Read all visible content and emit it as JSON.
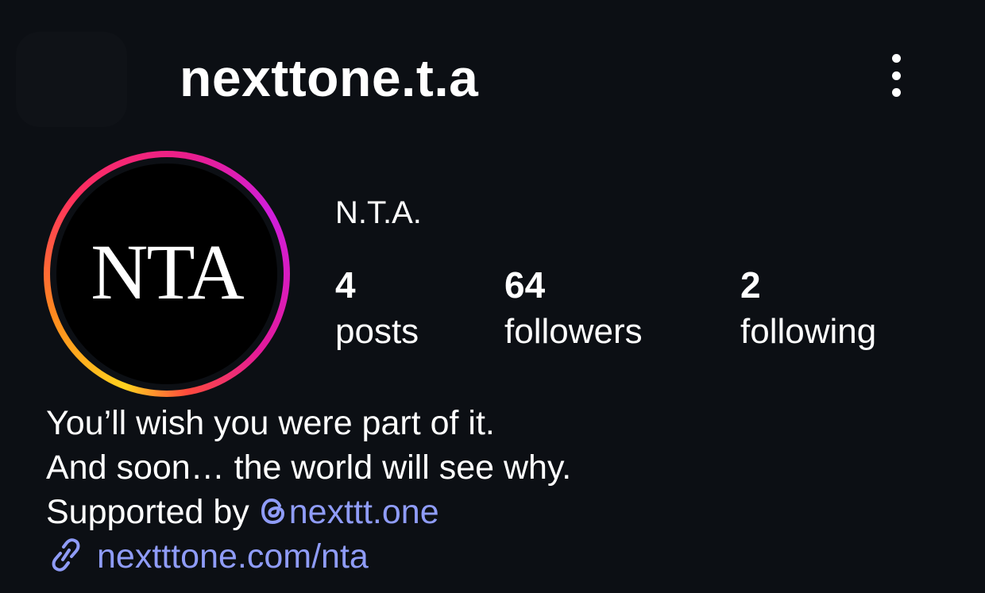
{
  "header": {
    "username": "nexttone.t.a",
    "more_icon": "more-vertical-icon"
  },
  "profile": {
    "avatar_text": "NTA",
    "display_name": "N.T.A.",
    "stats": [
      {
        "value": "4",
        "label": "posts"
      },
      {
        "value": "64",
        "label": "followers"
      },
      {
        "value": "2",
        "label": "following"
      }
    ]
  },
  "bio": {
    "line1": "You’ll wish you were part of it.",
    "line2": "And soon… the world will see why.",
    "supported_prefix": "Supported by",
    "supported_handle": "nexttt.one",
    "link_text": "nextttone.com/nta",
    "threads_icon": "threads-icon",
    "link_icon": "link-icon"
  },
  "colors": {
    "background": "#0c0f14",
    "link": "#8f9cf8",
    "text": "#ffffff"
  }
}
